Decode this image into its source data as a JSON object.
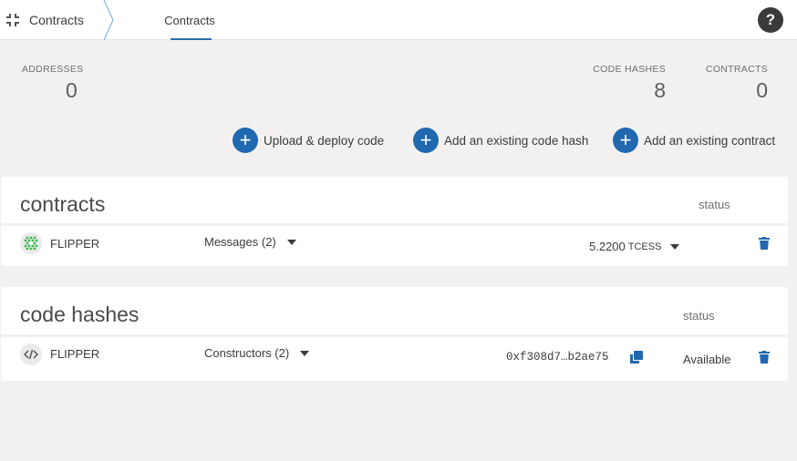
{
  "header": {
    "menu_label": "Contracts",
    "tab_label": "Contracts",
    "help_label": "?"
  },
  "stats": {
    "addresses": {
      "label": "ADDRESSES",
      "value": "0"
    },
    "code_hashes": {
      "label": "CODE HASHES",
      "value": "8"
    },
    "contracts": {
      "label": "CONTRACTS",
      "value": "0"
    }
  },
  "actions": {
    "upload": "Upload & deploy code",
    "add_code_hash": "Add an existing code hash",
    "add_contract": "Add an existing contract"
  },
  "contracts_section": {
    "title": "contracts",
    "status_header": "status",
    "rows": [
      {
        "name": "FLIPPER",
        "messages": "Messages (2)",
        "balance": "5.2200",
        "unit": "TCESS"
      }
    ]
  },
  "codehashes_section": {
    "title": "code hashes",
    "status_header": "status",
    "rows": [
      {
        "name": "FLIPPER",
        "constructors": "Constructors (2)",
        "hash": "0xf308d7…b2ae75",
        "status": "Available"
      }
    ]
  },
  "icons": {
    "menu": "contract-menu-icon",
    "help": "help-icon",
    "add": "plus-icon",
    "contract_avatar": "identicon-icon",
    "code": "code-icon",
    "delete": "trash-icon",
    "copy": "copy-icon",
    "caret": "caret-down-icon"
  },
  "colors": {
    "accent": "#2068b0",
    "background": "#f2f1f0",
    "card": "#ffffff",
    "identicon": "#3fb950"
  }
}
